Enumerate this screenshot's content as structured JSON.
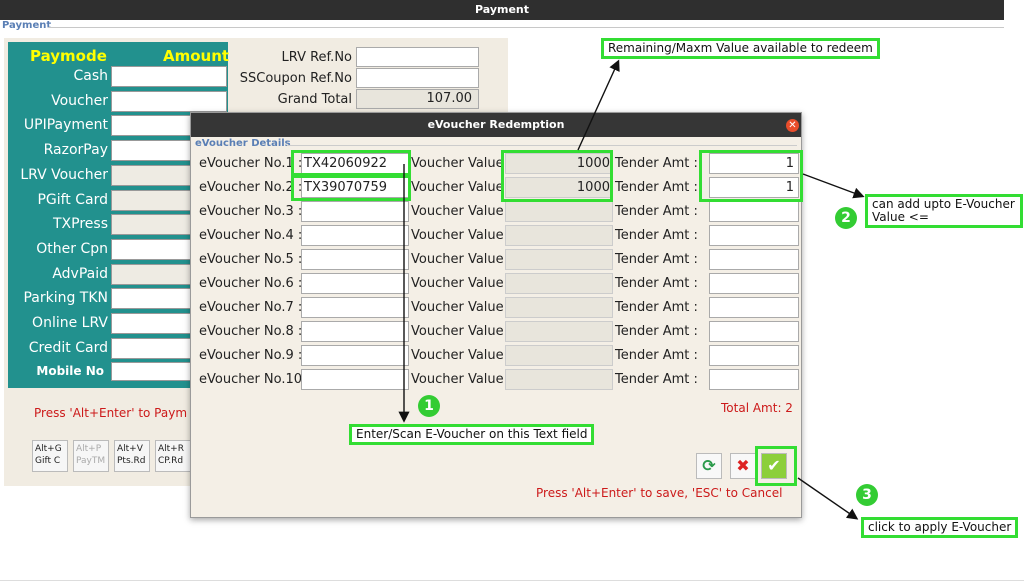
{
  "window": {
    "title": "Payment",
    "group_label": "Payment"
  },
  "paymode": {
    "header_mode": "Paymode",
    "header_amount": "Amount",
    "rows": [
      "Cash",
      "Voucher",
      "UPIPayment",
      "RazorPay",
      "LRV Voucher",
      "PGift Card",
      "TXPress",
      "Other Cpn",
      "AdvPaid",
      "Parking TKN",
      "Online LRV",
      "Credit Card"
    ],
    "mobile_label": "Mobile No"
  },
  "summary": {
    "lrv_ref_label": "LRV Ref.No",
    "sscoupon_label": "SSCoupon Ref.No",
    "grand_total_label": "Grand Total",
    "grand_total_value": "107.00"
  },
  "hint_text": "Press 'Alt+Enter' to Paym",
  "shortcut_buttons": [
    "Alt+G\nGift C",
    "Alt+P\nPayTM",
    "Alt+V\nPts.Rd",
    "Alt+R\nCP.Rd"
  ],
  "dialog": {
    "title": "eVoucher Redemption",
    "section_label": "eVoucher Details",
    "rows": [
      {
        "label": "eVoucher No.1 :",
        "number": "TX42060922",
        "value_label": "Voucher Value :",
        "value": "1000",
        "tender_label": "Tender Amt :",
        "tender": "1"
      },
      {
        "label": "eVoucher No.2 :",
        "number": "TX39070759",
        "value_label": "Voucher Value :",
        "value": "1000",
        "tender_label": "Tender Amt :",
        "tender": "1"
      },
      {
        "label": "eVoucher No.3 :",
        "number": "",
        "value_label": "Voucher Value :",
        "value": "",
        "tender_label": "Tender Amt :",
        "tender": ""
      },
      {
        "label": "eVoucher No.4 :",
        "number": "",
        "value_label": "Voucher Value :",
        "value": "",
        "tender_label": "Tender Amt :",
        "tender": ""
      },
      {
        "label": "eVoucher No.5 :",
        "number": "",
        "value_label": "Voucher Value :",
        "value": "",
        "tender_label": "Tender Amt :",
        "tender": ""
      },
      {
        "label": "eVoucher No.6 :",
        "number": "",
        "value_label": "Voucher Value :",
        "value": "",
        "tender_label": "Tender Amt :",
        "tender": ""
      },
      {
        "label": "eVoucher No.7 :",
        "number": "",
        "value_label": "Voucher Value :",
        "value": "",
        "tender_label": "Tender Amt :",
        "tender": ""
      },
      {
        "label": "eVoucher No.8 :",
        "number": "",
        "value_label": "Voucher Value :",
        "value": "",
        "tender_label": "Tender Amt :",
        "tender": ""
      },
      {
        "label": "eVoucher No.9 :",
        "number": "",
        "value_label": "Voucher Value :",
        "value": "",
        "tender_label": "Tender Amt :",
        "tender": ""
      },
      {
        "label": "eVoucher No.10 :",
        "number": "",
        "value_label": "Voucher Value :",
        "value": "",
        "tender_label": "Tender Amt :",
        "tender": ""
      }
    ],
    "total_text": "Total Amt: 2",
    "hint_text": "Press 'Alt+Enter' to save, 'ESC' to Cancel"
  },
  "annotations": {
    "remaining_text": "Remaining/Maxm Value available to redeem",
    "enter_scan_text": "Enter/Scan E-Voucher on this Text field",
    "can_add_text_line1": "can add upto E-Voucher",
    "can_add_text_line2": "Value <=",
    "apply_text": "click to apply E-Voucher",
    "badge1": "1",
    "badge2": "2",
    "badge3": "3"
  },
  "colors": {
    "paymode_bg": "#22918e",
    "paymode_header": "#ffff00",
    "hint_red": "#cc1a1a",
    "highlight_green": "#33dd33"
  }
}
